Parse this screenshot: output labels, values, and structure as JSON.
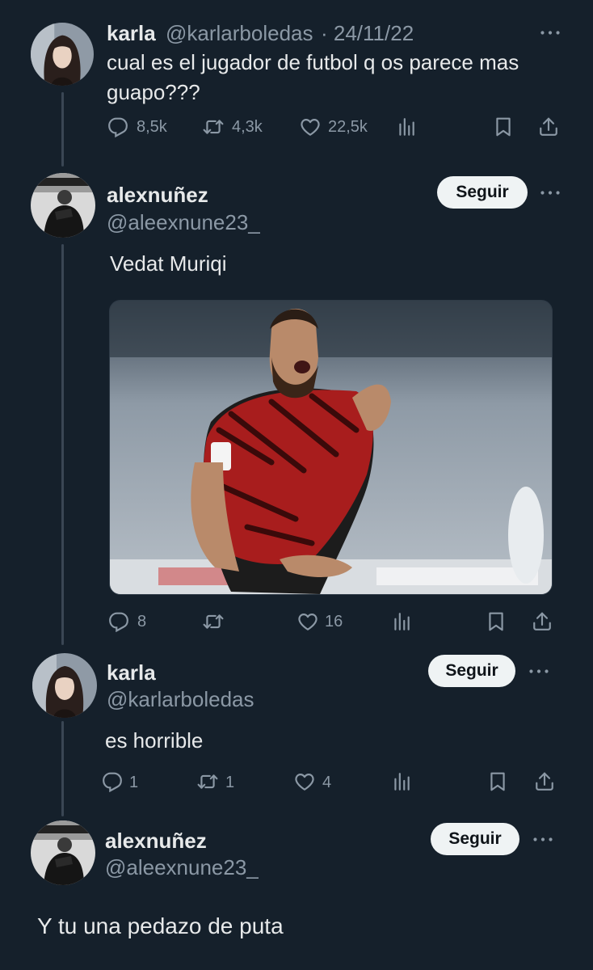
{
  "tweet1": {
    "name": "karla",
    "handle": "@karlarboledas",
    "date": "· 24/11/22",
    "text_line1": "cual es el jugador de futbol q os parece mas",
    "text_line2": "guapo???",
    "replies": "8,5k",
    "retweets": "4,3k",
    "likes": "22,5k"
  },
  "reply1": {
    "name": "alexnuñez",
    "handle": "@aleexnune23_",
    "follow_label": "Seguir",
    "text": "Vedat Muriqi",
    "replies": "8",
    "retweets": "",
    "likes": "16"
  },
  "reply2": {
    "name": "karla",
    "handle": "@karlarboledas",
    "follow_label": "Seguir",
    "text": "es horrible",
    "replies": "1",
    "retweets": "1",
    "likes": "4"
  },
  "reply3": {
    "name": "alexnuñez",
    "handle": "@aleexnune23_",
    "follow_label": "Seguir",
    "text": "Y tu una pedazo de puta"
  },
  "colors": {
    "background": "#15202b",
    "text": "#e7e9ea",
    "muted": "#8b98a5",
    "button_bg": "#eff3f4",
    "button_text": "#0f1419"
  },
  "icons": [
    "reply-icon",
    "retweet-icon",
    "like-icon",
    "analytics-icon",
    "bookmark-icon",
    "share-icon",
    "more-icon"
  ]
}
